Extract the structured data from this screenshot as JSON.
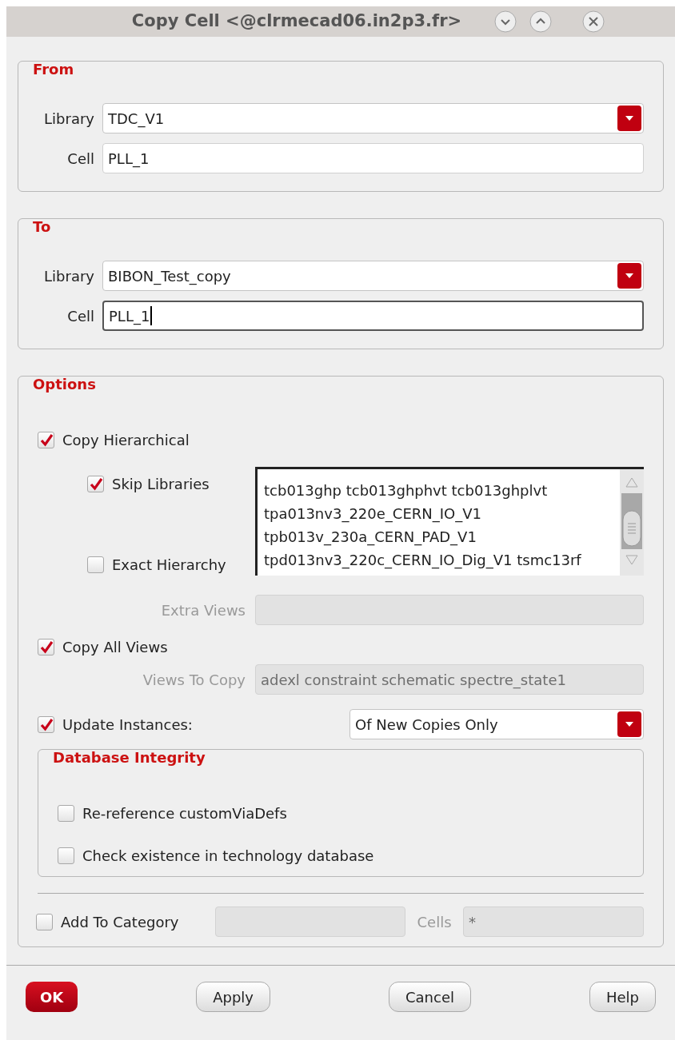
{
  "window": {
    "title": "Copy Cell <@clrmecad06.in2p3.fr>"
  },
  "from": {
    "title": "From",
    "library": {
      "label": "Library",
      "value": "TDC_V1"
    },
    "cell": {
      "label": "Cell",
      "value": "PLL_1",
      "focused": false
    }
  },
  "to": {
    "title": "To",
    "library": {
      "label": "Library",
      "value": "BIBON_Test_copy"
    },
    "cell": {
      "label": "Cell",
      "value": "PLL_1",
      "focused": true
    }
  },
  "options": {
    "title": "Options",
    "copy_hierarchical": {
      "label": "Copy Hierarchical",
      "checked": true
    },
    "skip_libraries": {
      "label": "Skip Libraries",
      "checked": true
    },
    "skip_list": [
      "tcb013ghp tcb013ghphvt tcb013ghplvt",
      "tpa013nv3_220e_CERN_IO_V1",
      "tpb013v_230a_CERN_PAD_V1",
      "tpd013nv3_220c_CERN_IO_Dig_V1 tsmc13rf"
    ],
    "exact_hierarchy": {
      "label": "Exact Hierarchy",
      "checked": false
    },
    "extra_views": {
      "label": "Extra Views",
      "disabled": true
    },
    "copy_all_views": {
      "label": "Copy All Views",
      "checked": true
    },
    "views_to_copy": {
      "label": "Views To Copy",
      "value": "adexl constraint schematic spectre_state1",
      "disabled": true
    },
    "update_instances": {
      "label": "Update Instances:",
      "checked": true,
      "value": "Of New Copies Only"
    },
    "database_integrity": {
      "title": "Database Integrity",
      "items": [
        {
          "label": "Re-reference customViaDefs",
          "checked": false
        },
        {
          "label": "Check existence in technology database",
          "checked": false
        }
      ]
    },
    "add_to_category": {
      "label": "Add To Category",
      "checked": false,
      "cells_label": "Cells",
      "cells_value": "*",
      "disabled": true
    }
  },
  "buttons": [
    {
      "label": "OK",
      "kind": "primary"
    },
    {
      "label": "Apply",
      "kind": "normal"
    },
    {
      "label": "Cancel",
      "kind": "normal"
    },
    {
      "label": "Help",
      "kind": "normal"
    }
  ]
}
